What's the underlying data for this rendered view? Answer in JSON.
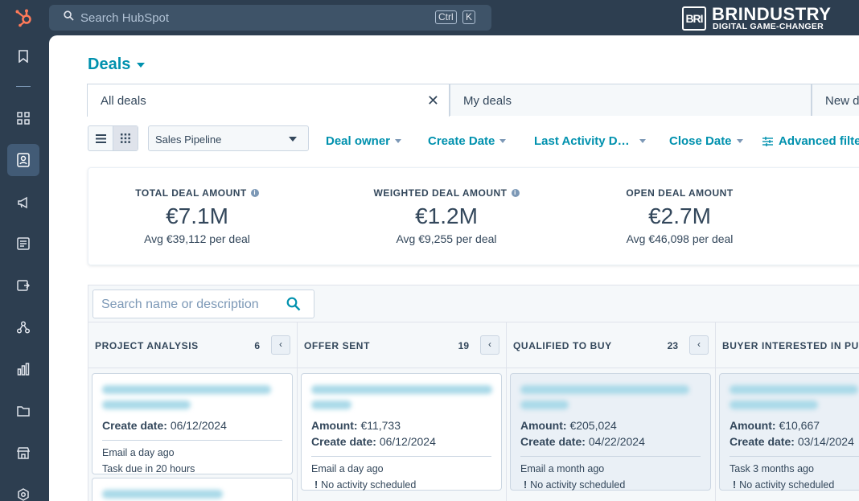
{
  "topbar": {
    "search_placeholder": "Search HubSpot",
    "shortcut_ctrl": "Ctrl",
    "shortcut_key": "K"
  },
  "brand": {
    "mark": "BRI",
    "name": "BRINDUSTRY",
    "tagline": "DIGITAL GAME-CHANGER"
  },
  "page": {
    "title": "Deals"
  },
  "tabs": [
    {
      "label": "All deals"
    },
    {
      "label": "My deals"
    },
    {
      "label": "New d"
    }
  ],
  "toolbar": {
    "pipeline": "Sales Pipeline",
    "filters": [
      "Deal owner",
      "Create Date",
      "Last Activity D…",
      "Close Date",
      "Advanced filte"
    ]
  },
  "stats": [
    {
      "label": "TOTAL DEAL AMOUNT",
      "value": "€7.1M",
      "sub": "Avg €39,112 per deal"
    },
    {
      "label": "WEIGHTED DEAL AMOUNT",
      "value": "€1.2M",
      "sub": "Avg €9,255 per deal"
    },
    {
      "label": "OPEN DEAL AMOUNT",
      "value": "€2.7M",
      "sub": "Avg €46,098 per deal"
    }
  ],
  "board": {
    "search_placeholder": "Search name or description",
    "columns": [
      {
        "title": "PROJECT ANALYSIS",
        "count": "6",
        "cards": [
          {
            "lines": [
              {
                "k": "Create date:",
                "v": "06/12/2024"
              }
            ],
            "activity": [
              "Email a day ago",
              "Task due in 20 hours"
            ]
          }
        ]
      },
      {
        "title": "OFFER SENT",
        "count": "19",
        "cards": [
          {
            "lines": [
              {
                "k": "Amount:",
                "v": "€11,733"
              },
              {
                "k": "Create date:",
                "v": "06/12/2024"
              }
            ],
            "activity": [
              "Email a day ago",
              "No activity scheduled"
            ]
          }
        ]
      },
      {
        "title": "QUALIFIED TO BUY",
        "count": "23",
        "cards": [
          {
            "lines": [
              {
                "k": "Amount:",
                "v": "€205,024"
              },
              {
                "k": "Create date:",
                "v": "04/22/2024"
              }
            ],
            "activity": [
              "Email a month ago",
              "No activity scheduled"
            ]
          }
        ]
      },
      {
        "title": "BUYER INTERESTED IN PUR",
        "count": "",
        "cards": [
          {
            "lines": [
              {
                "k": "Amount:",
                "v": "€10,667"
              },
              {
                "k": "Create date:",
                "v": "03/14/2024"
              }
            ],
            "activity": [
              "Task 3 months ago",
              "No activity scheduled"
            ]
          }
        ]
      }
    ]
  },
  "colors": {
    "sidebar": "#2d3e50",
    "accent": "#0091ae",
    "hubspot_orange": "#ff7a59",
    "text": "#33475b"
  }
}
